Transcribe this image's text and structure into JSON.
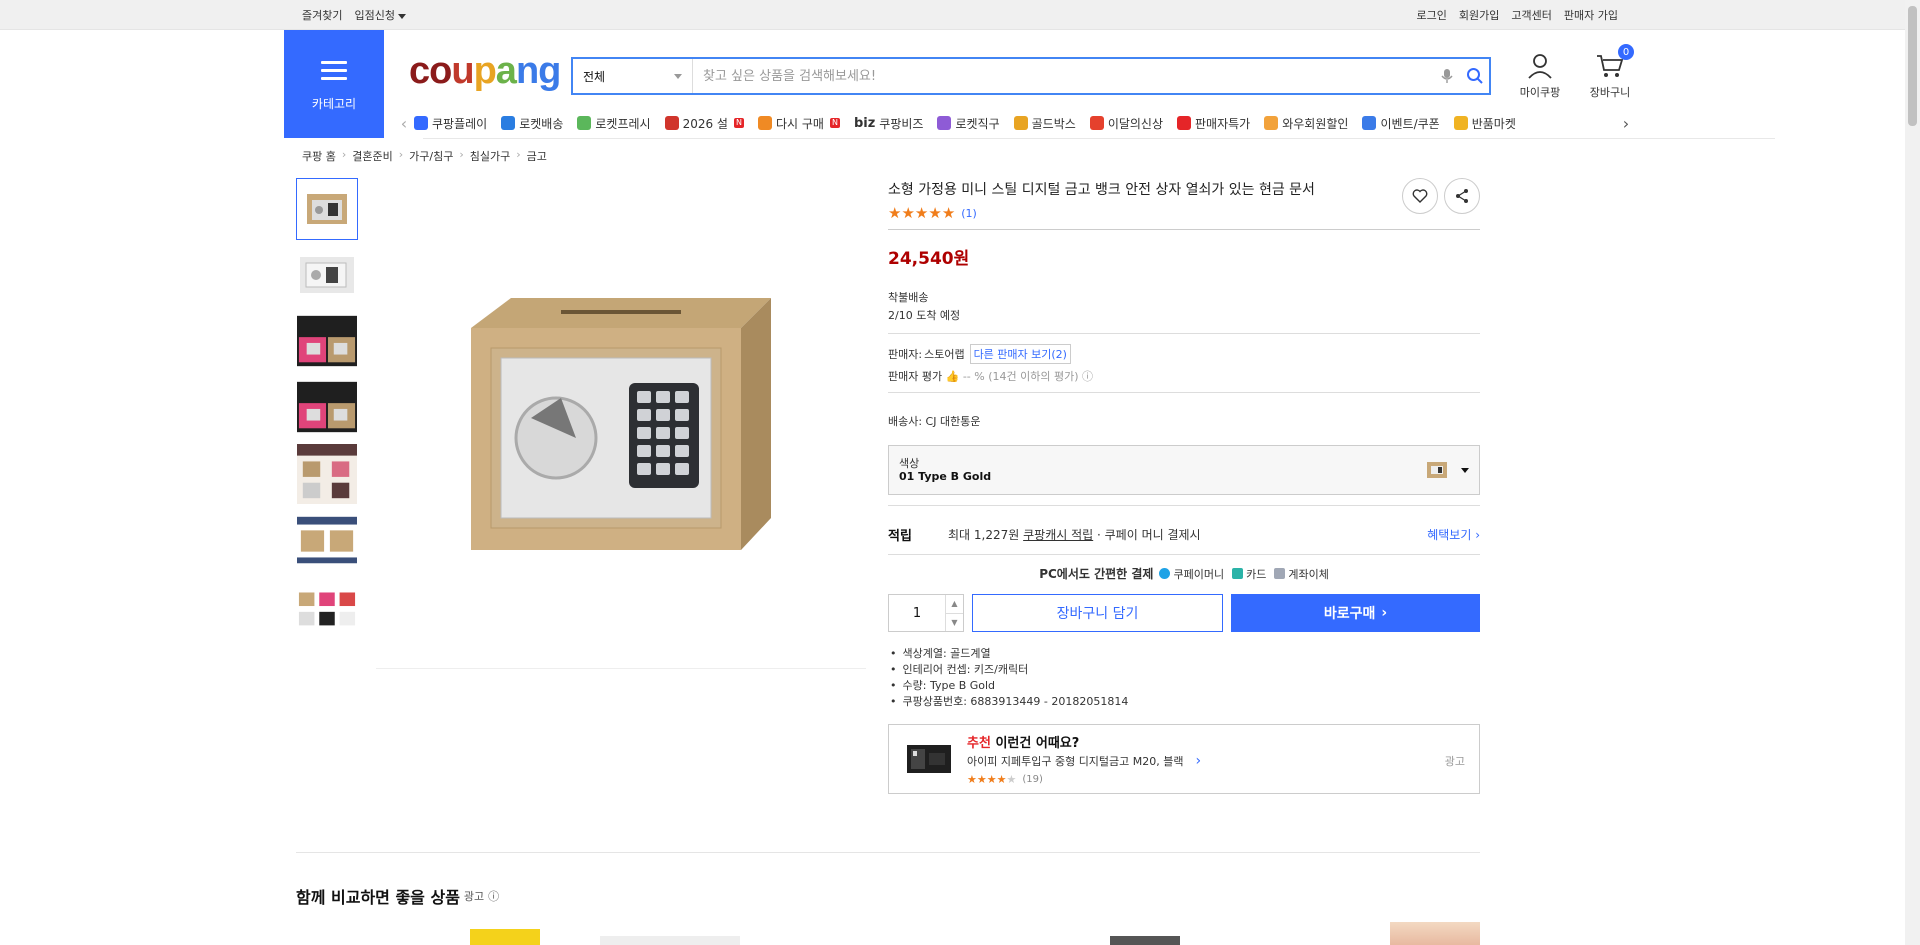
{
  "topbar": {
    "left": [
      "즐겨찾기",
      "입점신청"
    ],
    "right": [
      "로그인",
      "회원가입",
      "고객센터",
      "판매자 가입"
    ]
  },
  "header": {
    "category_label": "카테고리",
    "logo": [
      "c",
      "o",
      "u",
      "p",
      "a",
      "n",
      "g"
    ],
    "search_scope": "전체",
    "search_placeholder": "찾고 싶은 상품을 검색해보세요!",
    "mycoupang_label": "마이쿠팡",
    "cart_label": "장바구니",
    "cart_count": "0"
  },
  "nav": {
    "items": [
      {
        "label": "쿠팡플레이",
        "color": "#346aff"
      },
      {
        "label": "로켓배송",
        "color": "#2a7de1"
      },
      {
        "label": "로켓프레시",
        "color": "#5bb75b"
      },
      {
        "label": "2026 설",
        "color": "#d0352c",
        "badge": "N"
      },
      {
        "label": "다시 구매",
        "color": "#f08a24",
        "badge": "N"
      },
      {
        "label": "쿠팡비즈",
        "prefix": "biz"
      },
      {
        "label": "로켓직구",
        "color": "#8e5bd6"
      },
      {
        "label": "골드박스",
        "color": "#e8a423"
      },
      {
        "label": "이달의신상",
        "color": "#e5412d"
      },
      {
        "label": "판매자특가",
        "color": "#e52528"
      },
      {
        "label": "와우회원할인",
        "color": "#f2a23b"
      },
      {
        "label": "이벤트/쿠폰",
        "color": "#3b7be8"
      },
      {
        "label": "반품마켓",
        "color": "#f0b323"
      }
    ]
  },
  "breadcrumb": [
    "쿠팡 홈",
    "결혼준비",
    "가구/침구",
    "침실가구",
    "금고"
  ],
  "product": {
    "title": "소형 가정용 미니 스틸 디지털 금고 뱅크 안전 상자 열쇠가 있는 현금 문서",
    "rating_stars": 5,
    "review_count": "(1)",
    "price": "24,540원",
    "shipping_type": "착불배송",
    "arrival": "2/10 도착 예정",
    "seller_label": "판매자:",
    "seller_name": "스토어랩",
    "other_sellers": "다른 판매자 보기(2)",
    "seller_eval_label": "판매자 평가",
    "seller_eval_value": "-- % (14건 이하의 평가)",
    "carrier": "배송사: CJ 대한통운",
    "option_label": "색상",
    "option_value": "01 Type B Gold",
    "reward_label": "적립",
    "reward_text_1": "최대 1,227원",
    "reward_text_2": "쿠팡캐시 적립",
    "reward_text_3": "· 쿠페이 머니 결제시",
    "reward_more": "혜택보기 ›",
    "pay_title": "PC에서도 간편한 결제",
    "pay_methods": [
      {
        "label": "쿠페이머니",
        "color": "#1ea2e6"
      },
      {
        "label": "카드",
        "color": "#2bb3a8"
      },
      {
        "label": "계좌이체",
        "color": "#a0a7b5"
      }
    ],
    "quantity": "1",
    "cart_button": "장바구니 담기",
    "buy_button": "바로구매",
    "specs": [
      "색상계열: 골드계열",
      "인테리어 컨셉: 키즈/캐릭터",
      "수량: Type B Gold",
      "쿠팡상품번호: 6883913449 - 20182051814"
    ]
  },
  "recommend": {
    "title_red": "추천",
    "title_rest": " 이런건 어때요?",
    "name": "아이피 지페투입구 중형 디지털금고 M20, 블랙",
    "stars": 4,
    "count": "(19)",
    "ad": "광고"
  },
  "compare": {
    "title": "함께 비교하면 좋을 상품",
    "ad": "광고"
  },
  "colors": {
    "accent": "#346aff",
    "price": "#ae0000",
    "star": "#f07d1b"
  }
}
